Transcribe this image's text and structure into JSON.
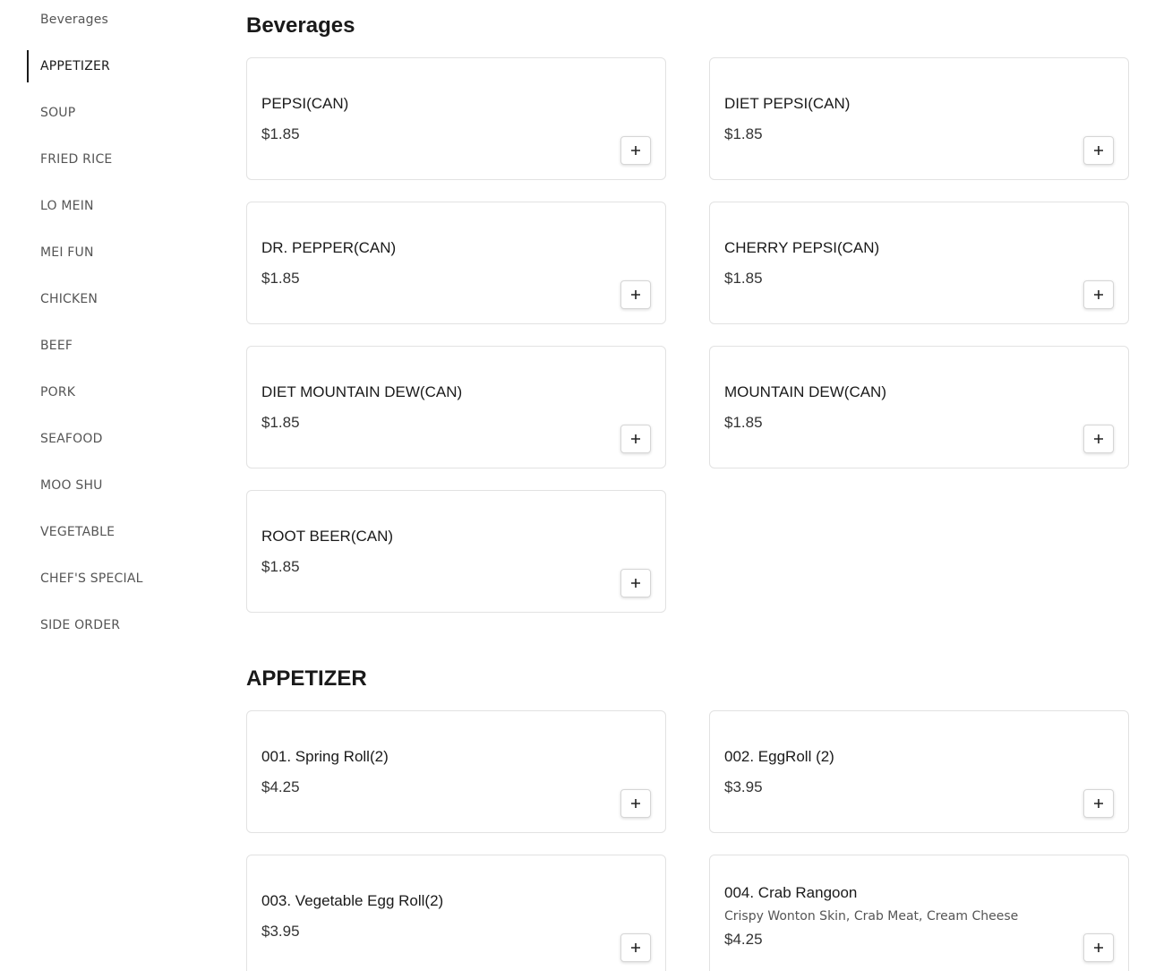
{
  "sidebar": {
    "items": [
      {
        "label": "Beverages"
      },
      {
        "label": "APPETIZER",
        "active": true
      },
      {
        "label": "SOUP"
      },
      {
        "label": "FRIED RICE"
      },
      {
        "label": "LO MEIN"
      },
      {
        "label": "MEI FUN"
      },
      {
        "label": "CHICKEN"
      },
      {
        "label": "BEEF"
      },
      {
        "label": "PORK"
      },
      {
        "label": "SEAFOOD"
      },
      {
        "label": "MOO SHU"
      },
      {
        "label": "VEGETABLE"
      },
      {
        "label": "CHEF'S SPECIAL"
      },
      {
        "label": "SIDE ORDER"
      }
    ]
  },
  "sections": [
    {
      "title": "Beverages",
      "items": [
        {
          "name": "PEPSI(CAN)",
          "price": "$1.85"
        },
        {
          "name": "DIET PEPSI(CAN)",
          "price": "$1.85"
        },
        {
          "name": "DR. PEPPER(CAN)",
          "price": "$1.85"
        },
        {
          "name": "CHERRY PEPSI(CAN)",
          "price": "$1.85"
        },
        {
          "name": "DIET MOUNTAIN DEW(CAN)",
          "price": "$1.85"
        },
        {
          "name": "MOUNTAIN DEW(CAN)",
          "price": "$1.85"
        },
        {
          "name": "ROOT BEER(CAN)",
          "price": "$1.85"
        }
      ]
    },
    {
      "title": "APPETIZER",
      "items": [
        {
          "name": "001. Spring Roll(2)",
          "price": "$4.25"
        },
        {
          "name": "002. EggRoll (2)",
          "price": "$3.95"
        },
        {
          "name": "003. Vegetable Egg Roll(2)",
          "price": "$3.95"
        },
        {
          "name": "004. Crab Rangoon",
          "description": "Crispy Wonton Skin, Crab Meat, Cream Cheese",
          "price": "$4.25"
        }
      ]
    }
  ],
  "icons": {
    "add": "plus-icon"
  }
}
